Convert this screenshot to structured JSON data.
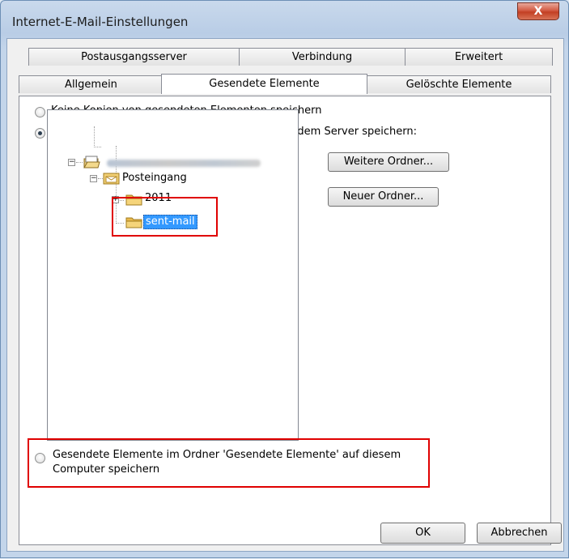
{
  "window": {
    "title": "Internet-E-Mail-Einstellungen",
    "close_label": "X"
  },
  "tabs_back": [
    "Postausgangsserver",
    "Verbindung",
    "Erweitert"
  ],
  "tabs_front": [
    "Allgemein",
    "Gesendete Elemente",
    "Gelöschte Elemente"
  ],
  "active_tab": "Gesendete Elemente",
  "options": {
    "no_copies": "Keine Kopien von gesendeten Elementen speichern",
    "server_folder": "Gesendete Elemente im folgenden Ordner auf dem Server speichern:",
    "local_folder_line1": "Gesendete Elemente im Ordner 'Gesendete Elemente' auf diesem",
    "local_folder_line2": "Computer speichern",
    "selected": "server_folder"
  },
  "tree": {
    "account": "",
    "inbox": "Posteingang",
    "folder_2011": "2011",
    "selected_folder": "sent-mail"
  },
  "buttons": {
    "more_folders": "Weitere Ordner...",
    "new_folder": "Neuer Ordner...",
    "ok": "OK",
    "cancel": "Abbrechen"
  },
  "colors": {
    "highlight": "#e00000",
    "selection": "#3399ff"
  }
}
